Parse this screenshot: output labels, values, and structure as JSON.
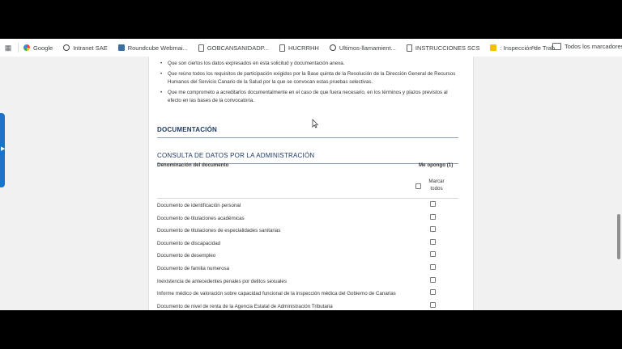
{
  "bookmarks": [
    {
      "label": "Google",
      "icon": "google-icon"
    },
    {
      "label": "Intranet SAE",
      "icon": "globe-icon"
    },
    {
      "label": "Roundcube Webmai...",
      "icon": "roundcube-icon"
    },
    {
      "label": "GOBCANSANIDADP...",
      "icon": "document-icon"
    },
    {
      "label": "HUCRRHH",
      "icon": "document-icon"
    },
    {
      "label": "Ultimos-llamamient...",
      "icon": "globe-icon"
    },
    {
      "label": "INSTRUCCIONES SCS",
      "icon": "document-icon"
    },
    {
      "label": ": Inspección de Trab...",
      "icon": "inspeccion-icon"
    }
  ],
  "bookmarks_more": "»",
  "all_bookmarks_label": "Todos los marcadores",
  "declarations": [
    "Que son ciertos los datos expresados en esta solicitud y documentación anexa.",
    "Que reúno todos los requisitos de participación exigidos por la Base quinta de la Resolución de la Dirección General de Recursos Humanos del Servicio Canario de la Salud por la que se convocan estas pruebas selectivas.",
    "Que me comprometo a acreditarlos documentalmente en el caso de que fuera necesario, en los términos y plazos previstos al efecto en las bases de la convocatoria."
  ],
  "documentacion_title": "DOCUMENTACIÓN",
  "consulta_title": "CONSULTA DE DATOS POR LA ADMINISTRACIÓN",
  "table": {
    "col_denominacion": "Denominación del documento",
    "col_me_opongo": "Me opongo (1)",
    "marcar_todos_line1": "Marcar",
    "marcar_todos_line2": "todos",
    "rows": [
      "Documento de identificación personal",
      "Documento de titulaciones académicas",
      "Documento de titulaciones de especialidades sanitarias",
      "Documento de discapacidad",
      "Documento de desempleo",
      "Documento de familia numerosa",
      "Inexistencia de antecedentes penales por delitos sexuales",
      "Informe médico de valoración sobre capacidad funcional de la inspección médica del Gobierno de Canarias",
      "Documento de nivel de renta de la Agencia Estatal de Administración Tributaria"
    ]
  },
  "colors": {
    "section_title": "#1f3b66",
    "section_rule": "#8aa0b6",
    "side_tab": "#1a73c8"
  }
}
